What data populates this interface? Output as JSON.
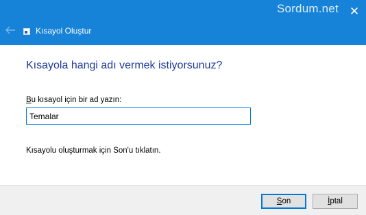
{
  "window": {
    "title": "Kısayol Oluştur",
    "watermark": "Sordum.net",
    "close_glyph": "✕",
    "back_icon": "back-arrow-icon",
    "app_icon": "shortcut-icon",
    "titlebar_color": "#1783d8"
  },
  "main": {
    "heading": "Kısayola hangi adı vermek istiyorsunuz?",
    "field_label_access_key": "B",
    "field_label_rest": "u kısayol için bir ad yazın:",
    "name_value": "Temalar",
    "hint": "Kısayolu oluşturmak için Son'u tıklatın."
  },
  "footer": {
    "next_access_key": "S",
    "next_rest": "on",
    "cancel_access_key": "İ",
    "cancel_rest": "ptal"
  }
}
